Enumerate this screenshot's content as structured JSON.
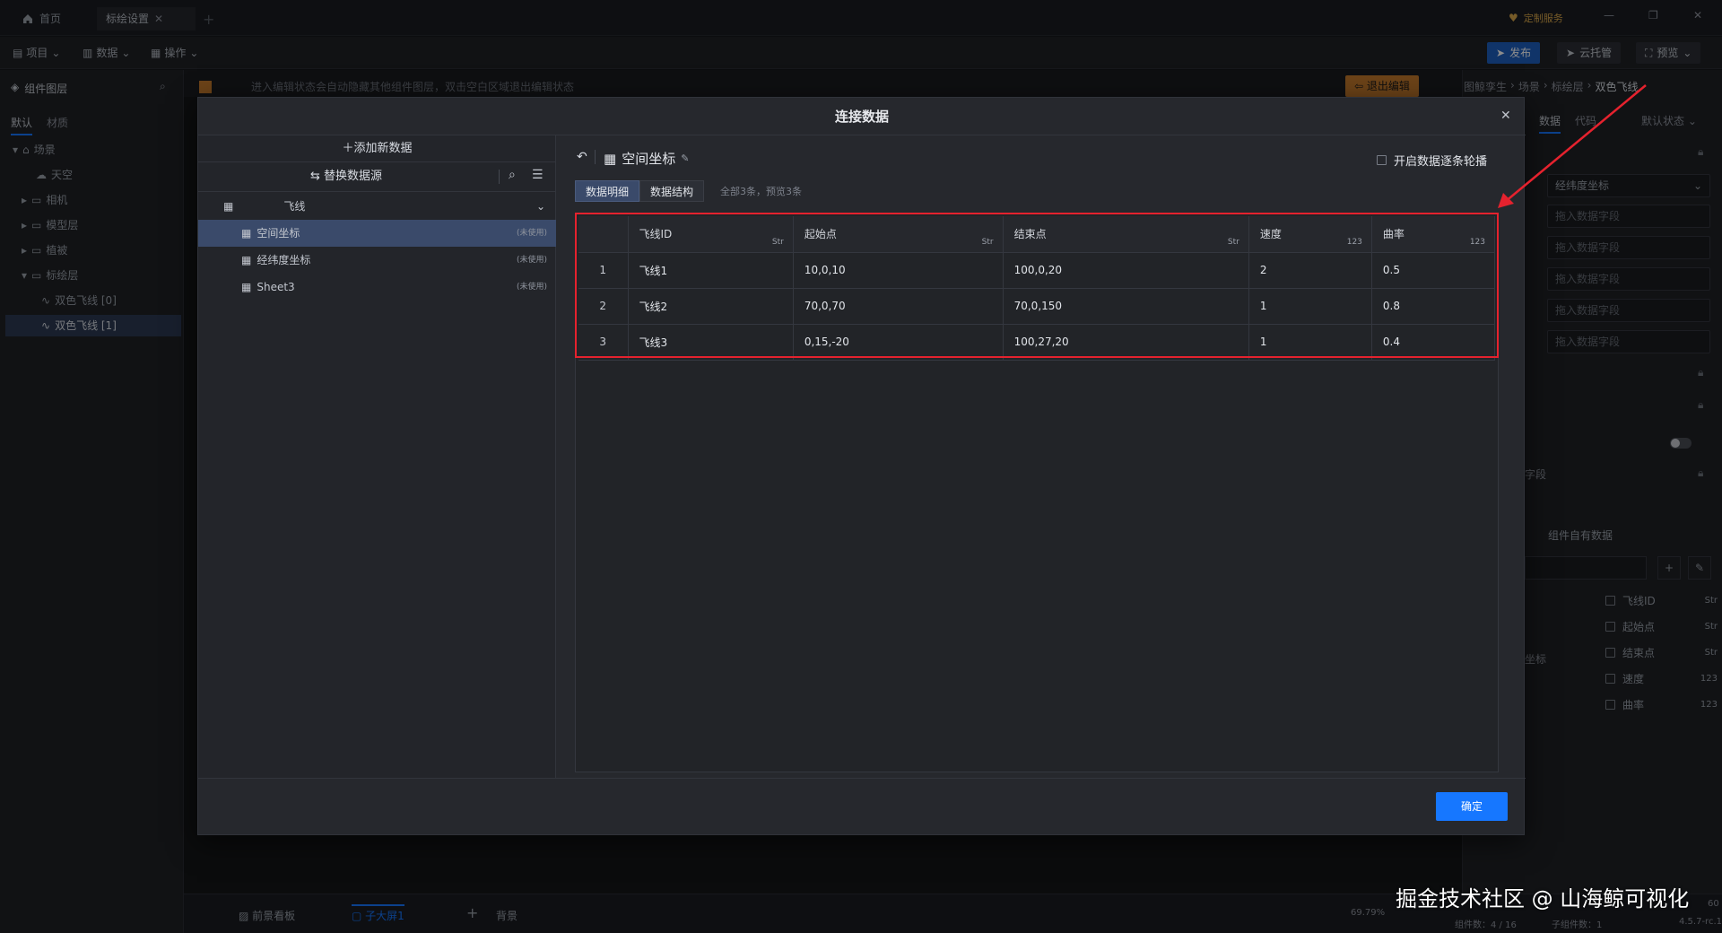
{
  "tabs": [
    {
      "label": "首页"
    },
    {
      "label": "标绘设置"
    }
  ],
  "titlebar": {
    "custom_service": "定制服务"
  },
  "toolbar": {
    "project": "项目",
    "data": "数据",
    "operate": "操作",
    "publish": "发布",
    "cloud_host": "云托管",
    "preview": "预览"
  },
  "sidebar": {
    "title": "组件图层",
    "tabs": [
      "默认",
      "材质"
    ],
    "tree": [
      {
        "label": "场景"
      },
      {
        "label": "天空"
      },
      {
        "label": "相机"
      },
      {
        "label": "模型层"
      },
      {
        "label": "植被"
      },
      {
        "label": "标绘层"
      },
      {
        "label": "双色飞线 [0]"
      },
      {
        "label": "双色飞线 [1]"
      }
    ]
  },
  "canvas": {
    "hint": "进入编辑状态会自动隐藏其他组件图层，双击空白区域退出编辑状态",
    "exit_edit": "退出编辑",
    "bottom_tabs": [
      "前景看板",
      "子大屏1",
      "背景"
    ],
    "zoom": "69.79%",
    "component_count": "组件数：4 / 16",
    "child_count": "子组件数：1",
    "version": "4.5.7-rc.1",
    "right_num": "60"
  },
  "right_panel": {
    "breadcrumb": [
      "图鲸孪生",
      "场景",
      "标绘层",
      "双色飞线"
    ],
    "tabs": [
      "数据",
      "代码"
    ],
    "state": "默认状态",
    "coord_select": "经纬度坐标",
    "drop_placeholder": "拖入数据字段",
    "field_label": "字段",
    "self_data": "组件自有数据",
    "coord_label": "坐标",
    "fields": [
      {
        "name": "飞线ID",
        "type": "Str"
      },
      {
        "name": "起始点",
        "type": "Str"
      },
      {
        "name": "结束点",
        "type": "Str"
      },
      {
        "name": "速度",
        "type": "123"
      },
      {
        "name": "曲率",
        "type": "123"
      }
    ]
  },
  "modal": {
    "title": "连接数据",
    "add_data": "添加新数据",
    "replace_source": "替换数据源",
    "group": "飞线",
    "sources": [
      {
        "name": "空间坐标",
        "status": "(未使用)"
      },
      {
        "name": "经纬度坐标",
        "status": "(未使用)"
      },
      {
        "name": "Sheet3",
        "status": "(未使用)"
      }
    ],
    "current_source": "空间坐标",
    "carousel_label": "开启数据逐条轮播",
    "tab_detail": "数据明细",
    "tab_structure": "数据结构",
    "summary": "全部3条，预览3条",
    "confirm": "确定",
    "table": {
      "headers": [
        {
          "name": "飞线ID",
          "type": "Str"
        },
        {
          "name": "起始点",
          "type": "Str"
        },
        {
          "name": "结束点",
          "type": "Str"
        },
        {
          "name": "速度",
          "type": "123"
        },
        {
          "name": "曲率",
          "type": "123"
        }
      ],
      "rows": [
        {
          "idx": "1",
          "cells": [
            "飞线1",
            "10,0,10",
            "100,0,20",
            "2",
            "0.5"
          ]
        },
        {
          "idx": "2",
          "cells": [
            "飞线2",
            "70,0,70",
            "70,0,150",
            "1",
            "0.8"
          ]
        },
        {
          "idx": "3",
          "cells": [
            "飞线3",
            "0,15,-20",
            "100,27,20",
            "1",
            "0.4"
          ]
        }
      ]
    }
  },
  "watermark": "掘金技术社区 @ 山海鲸可视化",
  "colors": {
    "accent": "#1677ff",
    "highlight": "#e5222e",
    "selected": "#3a4a6a"
  }
}
